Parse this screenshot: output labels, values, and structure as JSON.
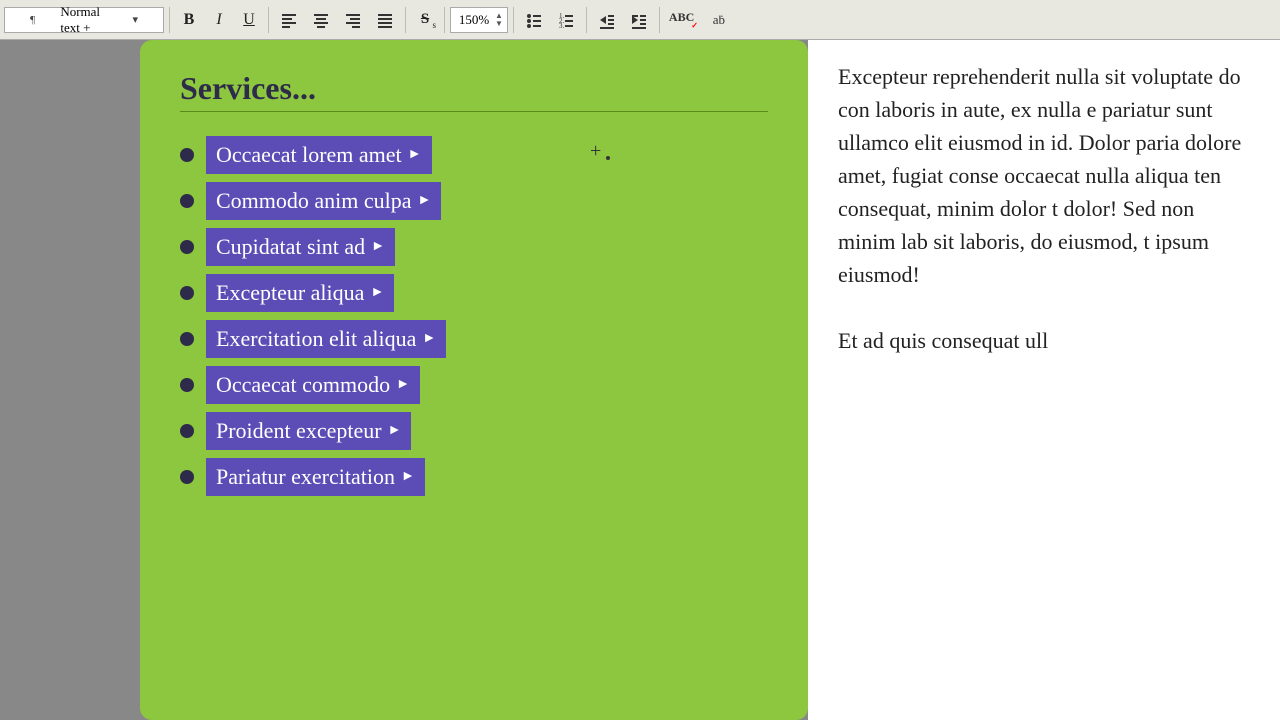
{
  "toolbar": {
    "style_label": "Normal text +",
    "bold_label": "B",
    "italic_label": "I",
    "underline_label": "U",
    "strikethrough_label": "S",
    "zoom_value": "150%",
    "icons": {
      "paragraph_icon": "¶",
      "align_left": "≡",
      "align_center": "≡",
      "align_right": "≡",
      "align_justify": "≡",
      "list_unordered": "≡",
      "list_ordered": "≡",
      "indent_left": "◁",
      "indent_right": "▷",
      "spellcheck": "ABC",
      "character": "aḃ"
    }
  },
  "green_panel": {
    "title": "Services...",
    "items": [
      {
        "label": "Occaecat lorem amet",
        "has_arrow": true
      },
      {
        "label": "Commodo anim culpa",
        "has_arrow": true
      },
      {
        "label": "Cupidatat sint ad",
        "has_arrow": true
      },
      {
        "label": "Excepteur aliqua",
        "has_arrow": true
      },
      {
        "label": "Exercitation elit aliqua",
        "has_arrow": true
      },
      {
        "label": "Occaecat commodo",
        "has_arrow": true
      },
      {
        "label": "Proident excepteur",
        "has_arrow": true
      },
      {
        "label": "Pariatur exercitation",
        "has_arrow": true
      }
    ]
  },
  "right_panel": {
    "text": "Excepteur reprehenderit nulla sit voluptate do con laboris in aute, ex nulla e pariatur sunt ullamco elit eiusmod in id. Dolor paria dolore amet, fugiat conse occaecat nulla aliqua ten consequat, minim dolor t dolor! Sed non minim lab sit laboris, do eiusmod, t ipsum eiusmod!\n\nEt ad quis consequat ull"
  }
}
